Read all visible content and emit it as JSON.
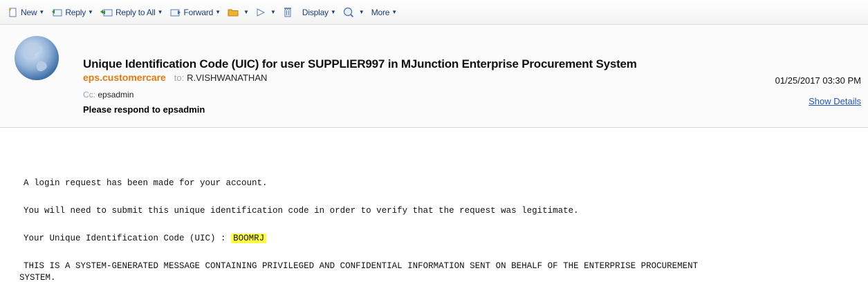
{
  "toolbar": {
    "new_label": "New",
    "reply_label": "Reply",
    "reply_all_label": "Reply to All",
    "forward_label": "Forward",
    "display_label": "Display",
    "more_label": "More"
  },
  "header": {
    "subject": "Unique Identification Code (UIC) for user SUPPLIER997 in MJunction Enterprise Procurement System",
    "sender": "eps.customercare",
    "to_label": "to:",
    "to_value": "R.VISHWANATHAN",
    "cc_label": "Cc:",
    "cc_value": "epsadmin",
    "respond_to": "Please respond to epsadmin",
    "datetime": "01/25/2017 03:30 PM",
    "show_details": "Show Details"
  },
  "body": {
    "line1": "A login request has been made for your account.",
    "line2": "You will need to submit this unique identification code in order to verify that the request was legitimate.",
    "line3_prefix": "Your Unique Identification Code (UIC) : ",
    "uic_code": "BOOMRJ",
    "line4a": "THIS IS A SYSTEM-GENERATED MESSAGE CONTAINING PRIVILEGED AND CONFIDENTIAL INFORMATION SENT ON BEHALF OF THE ENTERPRISE PROCUREMENT",
    "line4b": "SYSTEM."
  },
  "colors": {
    "sender": "#e07a10",
    "link": "#2255bb",
    "highlight": "#ffff40",
    "toolbar_text": "#1a3d7c"
  }
}
